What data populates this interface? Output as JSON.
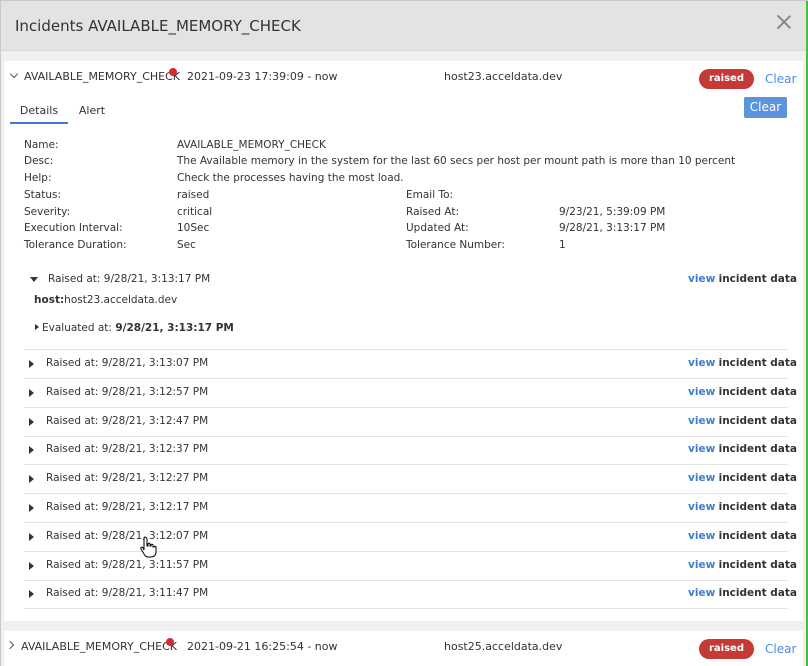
{
  "modal": {
    "title": "Incidents AVAILABLE_MEMORY_CHECK"
  },
  "incident1": {
    "name": "AVAILABLE_MEMORY_CHECK",
    "time": "2021-09-23 17:39:09 - now",
    "host": "host23.acceldata.dev",
    "badge": "raised",
    "clear_link": "Clear"
  },
  "tabs": {
    "details": "Details",
    "alert": "Alert"
  },
  "clear_button": "Clear",
  "details": {
    "name_label": "Name:",
    "name_value": "AVAILABLE_MEMORY_CHECK",
    "desc_label": "Desc:",
    "desc_value": "The Available memory in the system for the last 60 secs per host per mount path is more than 10 percent",
    "help_label": "Help:",
    "help_value": "Check the processes having the most load.",
    "status_label": "Status:",
    "status_value": "raised",
    "severity_label": "Severity:",
    "severity_value": "critical",
    "exec_label": "Execution Interval:",
    "exec_value": "10Sec",
    "tol_dur_label": "Tolerance Duration:",
    "tol_dur_value": "Sec",
    "email_label": "Email To:",
    "email_value": "",
    "raised_label": "Raised At:",
    "raised_value": "9/23/21, 5:39:09 PM",
    "updated_label": "Updated At:",
    "updated_value": "9/28/21, 3:13:17 PM",
    "tol_num_label": "Tolerance Number:",
    "tol_num_value": "1"
  },
  "expanded_event": {
    "raised": "Raised at: 9/28/21, 3:13:17 PM",
    "host_label": "host:",
    "host_value": "host23.acceldata.dev",
    "evaluated_label": "Evaluated at:",
    "evaluated_value": "9/28/21, 3:13:17 PM"
  },
  "view_link": {
    "view": "view",
    "rest": "incident data"
  },
  "events": [
    "Raised at: 9/28/21, 3:13:07 PM",
    "Raised at: 9/28/21, 3:12:57 PM",
    "Raised at: 9/28/21, 3:12:47 PM",
    "Raised at: 9/28/21, 3:12:37 PM",
    "Raised at: 9/28/21, 3:12:27 PM",
    "Raised at: 9/28/21, 3:12:17 PM",
    "Raised at: 9/28/21, 3:12:07 PM",
    "Raised at: 9/28/21, 3:11:57 PM",
    "Raised at: 9/28/21, 3:11:47 PM"
  ],
  "incident2": {
    "name": "AVAILABLE_MEMORY_CHECK",
    "time": "2021-09-21 16:25:54 - now",
    "host": "host25.acceldata.dev",
    "badge": "raised",
    "clear_link": "Clear"
  },
  "colors": {
    "badge": "#c33a36",
    "link": "#3d7bd0",
    "button": "#5b93dd",
    "dot": "#d42d2d"
  }
}
